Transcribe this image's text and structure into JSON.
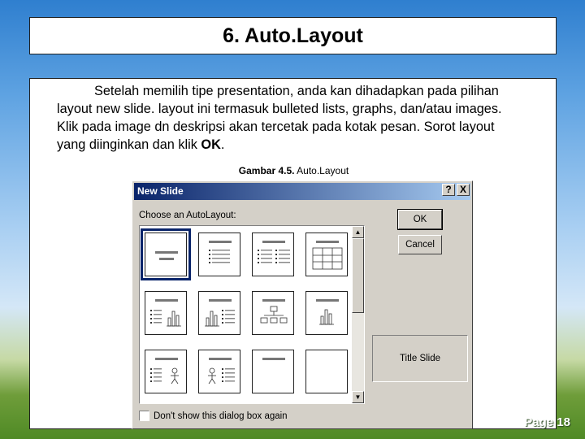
{
  "slide": {
    "title": "6. Auto.Layout",
    "paragraph_lines": [
      "Setelah memilih tipe presentation, anda kan dihadapkan pada pilihan",
      "layout new slide. layout ini termasuk bulleted lists, graphs, dan/atau images.",
      "Klik pada image dn deskripsi akan tercetak pada kotak pesan. Sorot layout",
      "yang diinginkan dan klik "
    ],
    "paragraph_bold_end": "OK",
    "paragraph_end": ".",
    "caption_bold": "Gambar 4.5.",
    "caption_text": " Auto.Layout",
    "page_number": "Page 18"
  },
  "dialog": {
    "title": "New Slide",
    "help_button": "?",
    "close_button": "X",
    "choose_label": "Choose an AutoLayout:",
    "ok_label": "OK",
    "cancel_label": "Cancel",
    "preview_label": "Title Slide",
    "checkbox_label": "Don't show this dialog box again",
    "scroll_up": "▲",
    "scroll_down": "▼",
    "selected_layout": "Title Slide"
  },
  "layouts": [
    {
      "name": "layout-title-slide"
    },
    {
      "name": "layout-bulleted-list"
    },
    {
      "name": "layout-two-column-text"
    },
    {
      "name": "layout-table"
    },
    {
      "name": "layout-text-and-chart"
    },
    {
      "name": "layout-chart-and-text"
    },
    {
      "name": "layout-organization-chart"
    },
    {
      "name": "layout-chart"
    },
    {
      "name": "layout-text-and-clip-art"
    },
    {
      "name": "layout-clip-art-and-text"
    },
    {
      "name": "layout-title-only"
    },
    {
      "name": "layout-blank"
    }
  ],
  "colors": {
    "titlebar_start": "#0a246a",
    "titlebar_end": "#a6caf0",
    "dialog_face": "#d4d0c8"
  }
}
